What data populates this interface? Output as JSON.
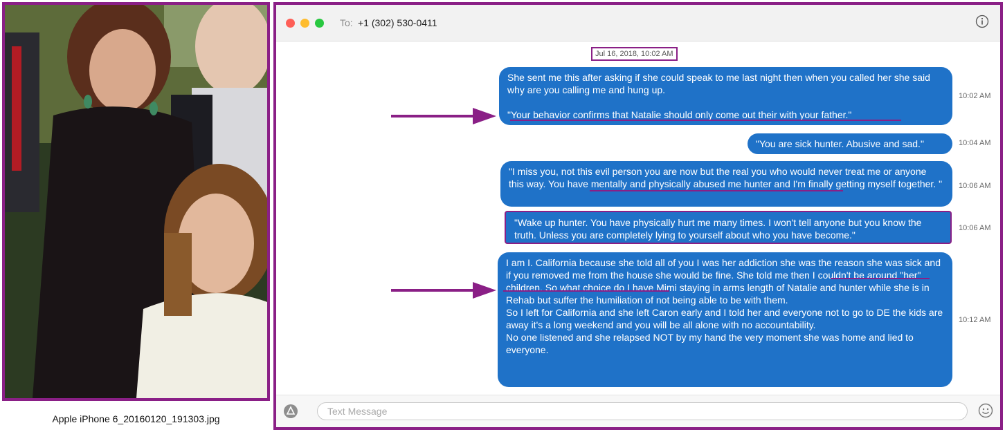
{
  "photo": {
    "caption": "Apple iPhone 6_20160120_191303.jpg"
  },
  "window": {
    "to_label": "To:",
    "to_number": "+1 (302) 530-0411",
    "date_stamp": "Jul 16, 2018, 10:02 AM",
    "input_placeholder": "Text Message",
    "icons": [
      "info-icon",
      "apps-icon",
      "emoji-icon",
      "arrow-icon"
    ]
  },
  "messages": [
    {
      "text": "She sent me this after asking if she could speak to me last night then when you called her she said why are you calling me and hung up.\n\n\"Your behavior confirms that Natalie should only come out their with your father.\"",
      "time": "10:02 AM"
    },
    {
      "text": "\"You are sick hunter. Abusive and sad.\"",
      "time": "10:04 AM"
    },
    {
      "text": "\"I miss you, not this evil person you are now but the real you who would never treat me or anyone this way. You have mentally and physically abused me hunter and I'm finally getting myself together. \"",
      "time": "10:06 AM"
    },
    {
      "text": "\"Wake up hunter. You have physically hurt me many times. I won't tell anyone but you know the truth. Unless you are completely lying to yourself about who you have become.\"",
      "time": "10:06 AM"
    },
    {
      "text": "I am I. California because she told all of you I was her addiction she was the reason she was sick and if you removed me from the house she would be fine. She told me then I couldn't be around \"her\" children. So what choice do I have Mimi staying in arms length of Natalie and hunter while she is in Rehab but suffer the humiliation of not being able to be with them.\nSo I left for California and she left Caron early and I told her and everyone not to go to DE the kids are away it's a long weekend and you will be all alone with no accountability.\nNo one listened and she relapsed NOT by my hand the very moment she was home and lied to everyone.",
      "time": "10:12 AM"
    }
  ],
  "colors": {
    "highlight_border": "#8a1f86",
    "bubble_blue": "#1f72c8"
  }
}
